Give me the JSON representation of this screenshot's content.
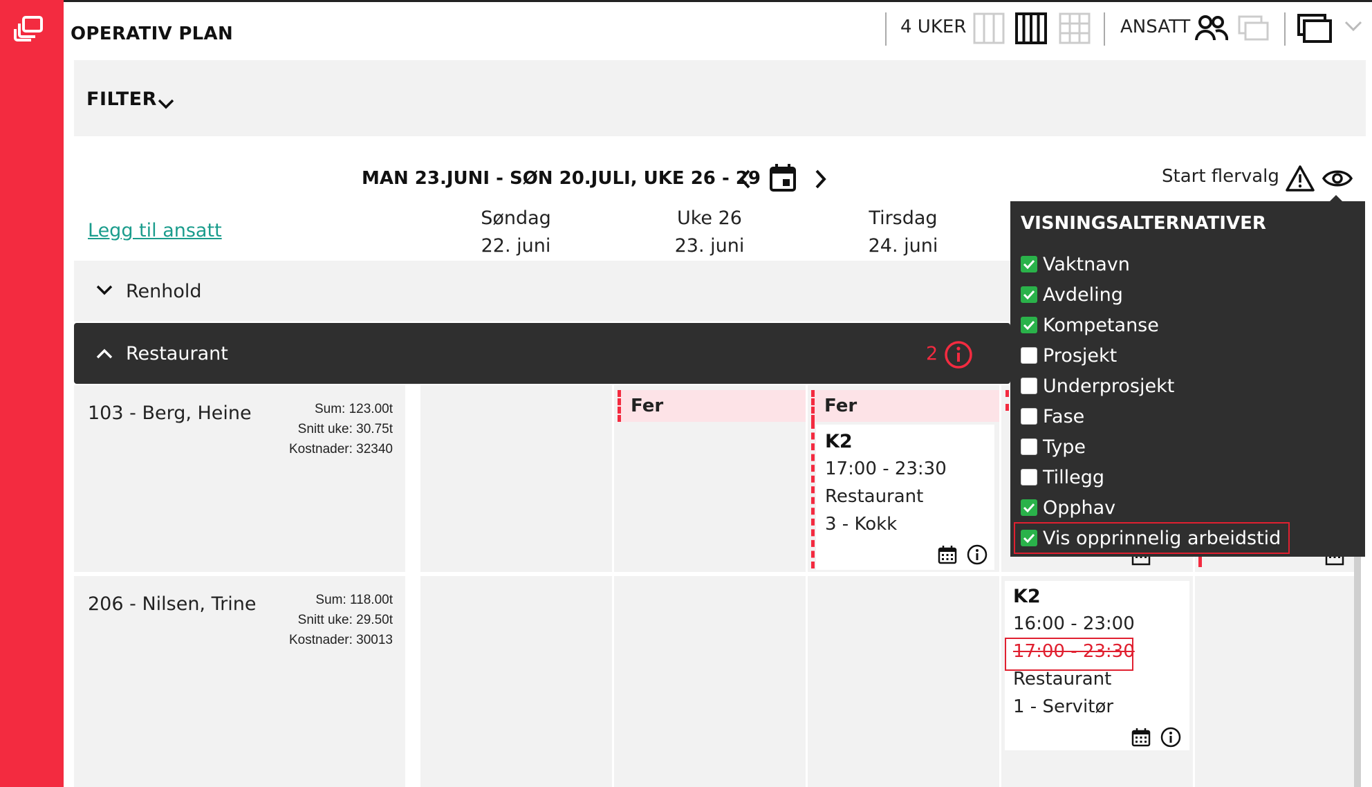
{
  "app": {
    "title": "OPERATIV PLAN"
  },
  "toolbar": {
    "weeks_label": "4 UKER",
    "employee_label": "ANSATT"
  },
  "filter": {
    "label": "FILTER"
  },
  "period": {
    "range": "MAN 23.JUNI - SØN 20.JULI, UKE 26 - 29"
  },
  "actions": {
    "start_multiselect": "Start flervalg",
    "add_employee": "Legg til ansatt"
  },
  "days": [
    {
      "name": "Søndag",
      "date": "22. juni"
    },
    {
      "name": "Uke 26",
      "date": "23. juni"
    },
    {
      "name": "Tirsdag",
      "date": "24. juni"
    }
  ],
  "groups": {
    "renhold": {
      "label": "Renhold"
    },
    "restaurant": {
      "label": "Restaurant",
      "count": "2"
    }
  },
  "employees": [
    {
      "name": "103 - Berg, Heine",
      "sum": "Sum: 123.00t",
      "avg": "Snitt uke: 30.75t",
      "cost": "Kostnader: 32340"
    },
    {
      "name": "206 - Nilsen, Trine",
      "sum": "Sum: 118.00t",
      "avg": "Snitt uke: 29.50t",
      "cost": "Kostnader: 30013"
    }
  ],
  "leave": {
    "label": "Fer"
  },
  "shifts": [
    {
      "title": "K2",
      "time": "17:00 - 23:30",
      "department": "Restaurant",
      "role": "3 - Kokk"
    },
    {
      "title": "K2",
      "time": "16:00 - 23:00",
      "original_time": "17:00 - 23:30",
      "department": "Restaurant",
      "role": "1 - Servitør"
    }
  ],
  "view_options": {
    "title": "VISNINGSALTERNATIVER",
    "items": [
      {
        "label": "Vaktnavn",
        "checked": true
      },
      {
        "label": "Avdeling",
        "checked": true
      },
      {
        "label": "Kompetanse",
        "checked": true
      },
      {
        "label": "Prosjekt",
        "checked": false
      },
      {
        "label": "Underprosjekt",
        "checked": false
      },
      {
        "label": "Fase",
        "checked": false
      },
      {
        "label": "Type",
        "checked": false
      },
      {
        "label": "Tillegg",
        "checked": false
      },
      {
        "label": "Opphav",
        "checked": true
      },
      {
        "label": "Vis opprinnelig arbeidstid",
        "checked": true
      }
    ]
  },
  "colors": {
    "brand_red": "#f32b40",
    "dark": "#2f2f2f",
    "check_green": "#2ab24a",
    "link_teal": "#1a9c8c",
    "leave_bg": "#fde3e7"
  }
}
